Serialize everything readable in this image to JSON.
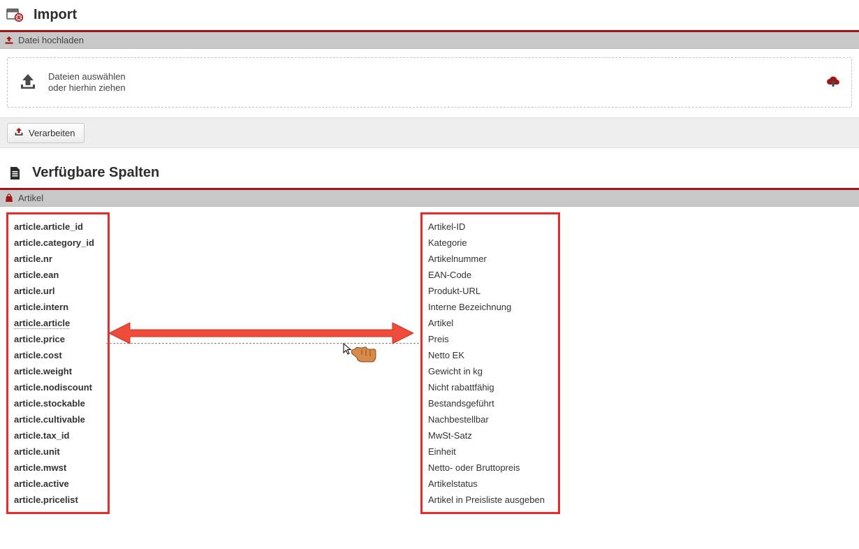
{
  "header": {
    "title": "Import"
  },
  "sections": {
    "upload_bar_label": "Datei hochladen",
    "articles_bar_label": "Artikel"
  },
  "dropzone": {
    "line1": "Dateien auswählen",
    "line2": "oder hierhin ziehen"
  },
  "toolbar": {
    "process_label": "Verarbeiten"
  },
  "header2": {
    "title": "Verfügbare Spalten"
  },
  "columns": {
    "left": [
      "article.article_id",
      "article.category_id",
      "article.nr",
      "article.ean",
      "article.url",
      "article.intern",
      "article.article",
      "article.price",
      "article.cost",
      "article.weight",
      "article.nodiscount",
      "article.stockable",
      "article.cultivable",
      "article.tax_id",
      "article.unit",
      "article.mwst",
      "article.active",
      "article.pricelist"
    ],
    "right": [
      "Artikel-ID",
      "Kategorie",
      "Artikelnummer",
      "EAN-Code",
      "Produkt-URL",
      "Interne Bezeichnung",
      "Artikel",
      "Preis",
      "Netto EK",
      "Gewicht in kg",
      "Nicht rabattfähig",
      "Bestandsgeführt",
      "Nachbestellbar",
      "MwSt-Satz",
      "Einheit",
      "Netto- oder Bruttopreis",
      "Artikelstatus",
      "Artikel in Preisliste ausgeben"
    ],
    "highlight_index": 6
  }
}
